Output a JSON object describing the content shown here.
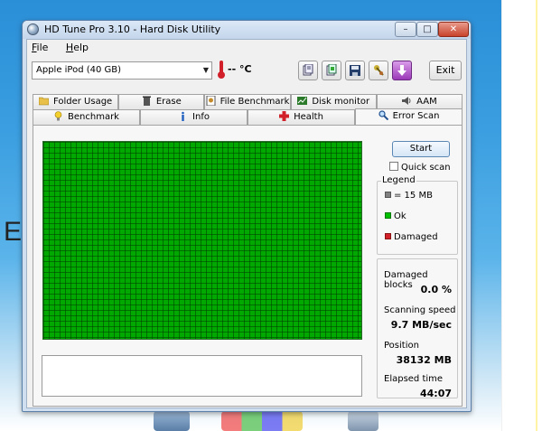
{
  "background": {
    "letter": "E"
  },
  "window": {
    "title": "HD Tune Pro 3.10 - Hard Disk Utility"
  },
  "menu": {
    "items": [
      {
        "label": "File",
        "accel": "F"
      },
      {
        "label": "Help",
        "accel": "H"
      }
    ]
  },
  "toolbar": {
    "drive": "Apple  iPod (40 GB)",
    "temperature": "-- °C",
    "exit_label": "Exit"
  },
  "tabs": {
    "row1": [
      {
        "label": "Folder Usage",
        "icon": "folder-icon"
      },
      {
        "label": "Erase",
        "icon": "trash-icon"
      },
      {
        "label": "File Benchmark",
        "icon": "file-benchmark-icon"
      },
      {
        "label": "Disk monitor",
        "icon": "disk-monitor-icon"
      },
      {
        "label": "AAM",
        "icon": "speaker-icon"
      }
    ],
    "row2": [
      {
        "label": "Benchmark",
        "icon": "lightbulb-icon"
      },
      {
        "label": "Info",
        "icon": "info-icon"
      },
      {
        "label": "Health",
        "icon": "health-cross-icon"
      },
      {
        "label": "Error Scan",
        "icon": "magnifier-icon",
        "active": true
      }
    ]
  },
  "scan": {
    "start_label": "Start",
    "quick_scan_label": "Quick scan",
    "quick_scan_checked": false,
    "legend": {
      "title": "Legend",
      "block_size": "= 15 MB",
      "ok": "Ok",
      "damaged": "Damaged"
    },
    "colors": {
      "ok": "#00a800",
      "damaged": "#d1202a",
      "block": "#808080"
    },
    "stats": {
      "damaged_label": "Damaged blocks",
      "damaged_value": "0.0 %",
      "speed_label": "Scanning speed",
      "speed_value": "9.7 MB/sec",
      "position_label": "Position",
      "position_value": "38132 MB",
      "elapsed_label": "Elapsed time",
      "elapsed_value": "44:07"
    }
  }
}
